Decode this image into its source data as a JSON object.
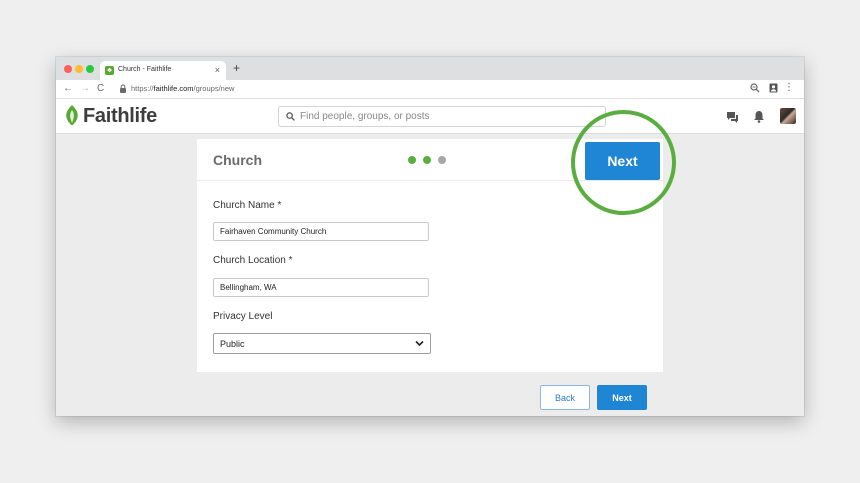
{
  "browser": {
    "tab_title": "Church - Faithlife",
    "tab_favicon_glyph": "♣",
    "close_glyph": "×",
    "new_tab_glyph": "+",
    "url_prefix": "https://",
    "url_host": "faithlife.com",
    "url_path": "/groups/new",
    "nav": {
      "back": "←",
      "forward": "→",
      "reload": "C"
    },
    "menu_glyph": "⋮"
  },
  "header": {
    "logo_text": "Faithlife",
    "search_placeholder": "Find people, groups, or posts",
    "icons": [
      "chat-icon",
      "bell-icon",
      "avatar"
    ]
  },
  "card": {
    "title": "Church",
    "steps": {
      "total": 3,
      "completed": 2
    },
    "fields": {
      "name_label": "Church Name *",
      "name_value": "Fairhaven Community Church",
      "location_label": "Church Location *",
      "location_value": "Bellingham, WA",
      "privacy_label": "Privacy Level",
      "privacy_value": "Public"
    }
  },
  "actions": {
    "next_highlight_label": "Next",
    "back_label": "Back",
    "next_label": "Next"
  },
  "colors": {
    "accent_blue": "#1f86d6",
    "step_green": "#5aad3f",
    "step_inactive": "#a7a7a7",
    "highlight_ring": "#5aad3f"
  }
}
